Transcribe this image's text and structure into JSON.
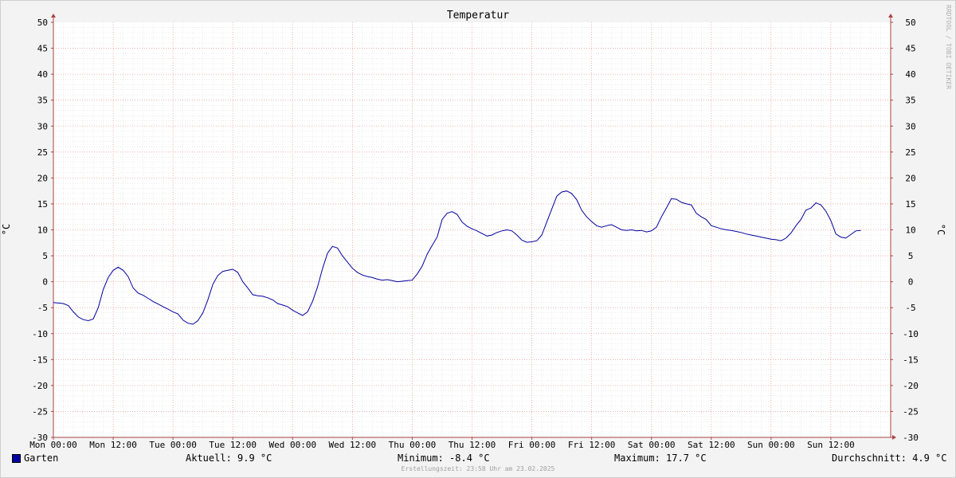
{
  "chart_data": {
    "type": "line",
    "title": "Temperatur",
    "ylabel_left": "°C",
    "ylabel_right": "°C",
    "ylim": [
      -30,
      50
    ],
    "yticks": [
      50,
      45,
      40,
      35,
      30,
      25,
      20,
      15,
      10,
      5,
      0,
      -5,
      -10,
      -15,
      -20,
      -25,
      -30
    ],
    "x_range_hours": [
      0,
      168
    ],
    "xticks": [
      {
        "label": "Mon 00:00",
        "h": 0
      },
      {
        "label": "Mon 12:00",
        "h": 12
      },
      {
        "label": "Tue 00:00",
        "h": 24
      },
      {
        "label": "Tue 12:00",
        "h": 36
      },
      {
        "label": "Wed 00:00",
        "h": 48
      },
      {
        "label": "Wed 12:00",
        "h": 60
      },
      {
        "label": "Thu 00:00",
        "h": 72
      },
      {
        "label": "Thu 12:00",
        "h": 84
      },
      {
        "label": "Fri 00:00",
        "h": 96
      },
      {
        "label": "Fri 12:00",
        "h": 108
      },
      {
        "label": "Sat 00:00",
        "h": 120
      },
      {
        "label": "Sat 12:00",
        "h": 132
      },
      {
        "label": "Sun 00:00",
        "h": 144
      },
      {
        "label": "Sun 12:00",
        "h": 156
      }
    ],
    "grid": true,
    "series": [
      {
        "name": "Garten",
        "color": "#0000a0",
        "x_hours": [
          0,
          2,
          3,
          4,
          5,
          6,
          7,
          8,
          9,
          10,
          11,
          12,
          13,
          14,
          15,
          16,
          17,
          18,
          19,
          20,
          21,
          22,
          23,
          24,
          25,
          26,
          27,
          28,
          29,
          30,
          31,
          32,
          33,
          34,
          35,
          36,
          37,
          38,
          39,
          40,
          41,
          42,
          43,
          44,
          45,
          46,
          47,
          48,
          49,
          50,
          51,
          52,
          53,
          54,
          55,
          56,
          57,
          58,
          59,
          60,
          61,
          62,
          63,
          64,
          65,
          66,
          67,
          68,
          69,
          70,
          71,
          72,
          73,
          74,
          75,
          76,
          77,
          78,
          79,
          80,
          81,
          82,
          83,
          84,
          85,
          86,
          87,
          88,
          89,
          90,
          91,
          92,
          93,
          94,
          95,
          96,
          97,
          98,
          99,
          100,
          101,
          102,
          103,
          104,
          105,
          106,
          107,
          108,
          109,
          110,
          111,
          112,
          113,
          114,
          115,
          116,
          117,
          118,
          119,
          120,
          121,
          122,
          123,
          124,
          125,
          126,
          127,
          128,
          129,
          130,
          131,
          132,
          133,
          134,
          135,
          136,
          137,
          138,
          139,
          140,
          141,
          142,
          143,
          144,
          145,
          146,
          147,
          148,
          149,
          150,
          151,
          152,
          153,
          154,
          155,
          156,
          157,
          158,
          159,
          160,
          161,
          162,
          163,
          164,
          165,
          166,
          167,
          168
        ],
        "values": [
          -4,
          -4.2,
          -4.6,
          -5.8,
          -6.8,
          -7.3,
          -7.5,
          -7.2,
          -5,
          -1.5,
          0.8,
          2.2,
          2.8,
          2.2,
          1,
          -1.2,
          -2.2,
          -2.6,
          -3.2,
          -3.8,
          -4.3,
          -4.8,
          -5.3,
          -5.8,
          -6.2,
          -7.4,
          -8,
          -8.2,
          -7.5,
          -6,
          -3.5,
          -0.5,
          1.2,
          2,
          2.2,
          2.4,
          1.8,
          0,
          -1.2,
          -2.5,
          -2.7,
          -2.8,
          -3.1,
          -3.5,
          -4.2,
          -4.5,
          -4.8,
          -5.5,
          -6,
          -6.5,
          -5.8,
          -3.8,
          -1,
          2.5,
          5.5,
          6.8,
          6.5,
          5,
          3.8,
          2.6,
          1.8,
          1.3,
          1,
          0.8,
          0.5,
          0.3,
          0.4,
          0.2,
          0,
          0.1,
          0.2,
          0.3,
          1.5,
          3,
          5.3,
          7,
          8.6,
          12,
          13.2,
          13.5,
          13,
          11.5,
          10.7,
          10.2,
          9.8,
          9.3,
          8.8,
          9,
          9.5,
          9.8,
          10,
          9.8,
          9,
          8,
          7.6,
          7.7,
          7.9,
          9,
          11.5,
          14,
          16.5,
          17.3,
          17.5,
          17,
          15.8,
          13.8,
          12.5,
          11.6,
          10.8,
          10.5,
          10.8,
          11,
          10.5,
          10,
          9.9,
          10,
          9.8,
          9.9,
          9.6,
          9.8,
          10.5,
          12.5,
          14.2,
          16,
          15.9,
          15.3,
          15,
          14.8,
          13.2,
          12.5,
          12,
          10.8,
          10.5,
          10.2,
          10,
          9.9,
          9.7,
          9.5,
          9.2,
          9,
          8.8,
          8.6,
          8.4,
          8.2,
          8.1,
          7.9,
          8.4,
          9.4,
          10.8,
          12,
          13.8,
          14.2,
          15.2,
          14.8,
          13.6,
          11.8,
          9.2,
          8.6,
          8.4,
          9.1,
          9.8,
          9.9
        ]
      }
    ]
  },
  "legend": {
    "series_name": "Garten",
    "aktuell": "Aktuell: 9.9 °C",
    "minimum": "Minimum: -8.4 °C",
    "maximum": "Maximum: 17.7 °C",
    "durchschnitt": "Durchschnitt: 4.9 °C"
  },
  "footer": "Erstellungszeit: 23:58 Uhr am 23.02.2025",
  "watermark": "RRDTOOL / TOBI OETIKER"
}
